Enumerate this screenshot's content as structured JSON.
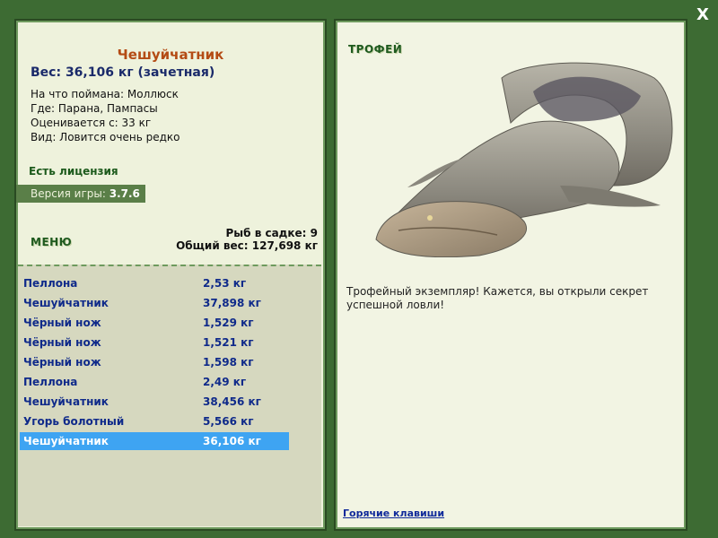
{
  "close_label": "X",
  "fish": {
    "name": "Чешуйчатник",
    "weight": "Вес: 36,106 кг (зачетная)",
    "caught_on": "На что поймана: Моллюск",
    "where": "Где: Парана, Пампасы",
    "rated_from": "Оценивается с: 33 кг",
    "kind": "Вид: Ловится очень редко"
  },
  "license": "Есть лицензия",
  "version": {
    "label": "Версия игры: ",
    "value": "3.7.6"
  },
  "menu_label": "МЕНЮ",
  "keep_net": {
    "count": "Рыб в садке: 9",
    "total": "Общий вес: 127,698 кг"
  },
  "catch_list": [
    {
      "name": "Пеллона",
      "weight": "2,53 кг"
    },
    {
      "name": "Чешуйчатник",
      "weight": "37,898 кг"
    },
    {
      "name": "Чёрный нож",
      "weight": "1,529 кг"
    },
    {
      "name": "Чёрный нож",
      "weight": "1,521 кг"
    },
    {
      "name": "Чёрный нож",
      "weight": "1,598 кг"
    },
    {
      "name": "Пеллона",
      "weight": "2,49 кг"
    },
    {
      "name": "Чешуйчатник",
      "weight": "38,456 кг"
    },
    {
      "name": "Угорь болотный",
      "weight": "5,566 кг"
    },
    {
      "name": "Чешуйчатник",
      "weight": "36,106 кг",
      "selected": true
    }
  ],
  "trophy": {
    "label": "ТРОФЕЙ",
    "text": "Трофейный экземпляр! Кажется, вы открыли секрет успешной ловли!"
  },
  "hotkeys": "Горячие клавиши",
  "colors": {
    "background": "#3d6b33",
    "selected_row": "#3ea4f2",
    "fish_name": "#b44b14"
  }
}
